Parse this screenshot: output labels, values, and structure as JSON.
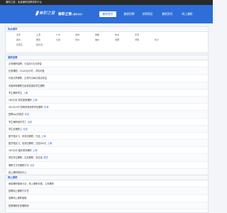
{
  "topbar": {
    "text": "兼职之窗，免费兼职招聘求职平台"
  },
  "header": {
    "logo_text": "兼职之窗",
    "brand_name": "兼职之窗",
    "brand_url": "[兼职城市]",
    "nav": [
      "兼职首页",
      "兼职招聘",
      "求职简历",
      "兼职资讯",
      "网上兼职"
    ],
    "active_nav": 0,
    "accent_color": "#2d6ed8"
  },
  "cities": {
    "title": "热点城市",
    "rows": [
      [
        "北京",
        "上海",
        "广州",
        "深圳",
        "成都",
        "杭州",
        "天津"
      ],
      [
        "郑州",
        "重庆",
        "大连",
        "苏州",
        "福州",
        "合肥",
        "济南",
        "长沙"
      ],
      [
        "石家庄",
        "哈尔滨"
      ]
    ]
  },
  "jobs": {
    "title": "兼职招聘",
    "items": [
      {
        "text": "正规兼职招聘，日结300元无押金",
        "date": ""
      },
      {
        "text": "在家兼职，20-40元/小时，手机可做",
        "date": ""
      },
      {
        "text": "抖音点赞兼职，正规平台每日稳定收益",
        "date": ""
      },
      {
        "text": "淘宝刷单兼职日结诚招宝妈学生兼职",
        "date": ""
      },
      {
        "text": "学生兼职学生",
        "date": "上海"
      },
      {
        "text": "180元/天 周末促销兼职",
        "date": "上海"
      },
      {
        "text": "240元/小时 急聘钟表维修学徒兼职",
        "date": "天津"
      },
      {
        "text": "招聘app试用员",
        "date": "北京"
      },
      {
        "text": "学生兼职临时学工",
        "date": "北京"
      },
      {
        "text": "学生证兼职工",
        "date": "北京"
      },
      {
        "text": "图书馆实习，奶茶店兼职，日结",
        "date": "上海"
      },
      {
        "text": "图书馆实习，奶茶店兼职，日结200元",
        "date": "上海"
      },
      {
        "text": "180元/天 婚庆现场兼职",
        "date": "上海"
      },
      {
        "text": "重庆学生兼职，交友兼职，包日结",
        "date": "重庆"
      },
      {
        "text": "兼职打字员兼职打字",
        "date": "北京"
      },
      {
        "text": "线上兼职网站中心",
        "date": ""
      }
    ]
  },
  "online": {
    "title": "网上兼职",
    "items": [
      {
        "text": "网络兼职推荐大全，网上兼职可做，工资兼职",
        "date": ""
      },
      {
        "text": "招聘网上兼职打字员",
        "date": ""
      },
      {
        "text": "招聘网上兼职客服",
        "date": ""
      },
      {
        "text": "招聘兼职在家兼职网",
        "date": ""
      }
    ]
  }
}
